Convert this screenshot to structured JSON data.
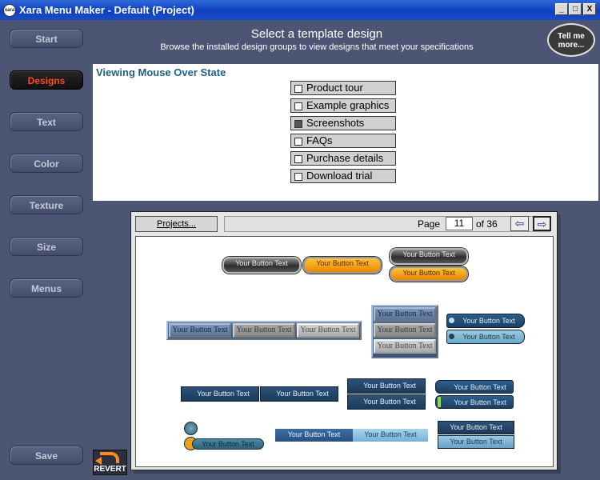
{
  "window": {
    "title": "Xara Menu Maker - Default (Project)",
    "minimize_glyph": "_",
    "maximize_glyph": "□",
    "close_glyph": "X"
  },
  "sidebar": {
    "items": [
      {
        "label": "Start",
        "active": false
      },
      {
        "label": "Designs",
        "active": true
      },
      {
        "label": "Text",
        "active": false
      },
      {
        "label": "Color",
        "active": false
      },
      {
        "label": "Texture",
        "active": false
      },
      {
        "label": "Size",
        "active": false
      },
      {
        "label": "Menus",
        "active": false
      }
    ],
    "save_label": "Save"
  },
  "header": {
    "title": "Select a template design",
    "subtitle": "Browse the installed design groups to view designs that meet your specifications",
    "tell_me_line1": "Tell me",
    "tell_me_line2": "more..."
  },
  "preview": {
    "label": "Viewing Mouse Over State",
    "items": [
      {
        "label": "Product tour",
        "hover": false
      },
      {
        "label": "Example graphics",
        "hover": false
      },
      {
        "label": "Screenshots",
        "hover": true
      },
      {
        "label": "FAQs",
        "hover": false
      },
      {
        "label": "Purchase details",
        "hover": false
      },
      {
        "label": "Download trial",
        "hover": false
      }
    ]
  },
  "browser": {
    "projects_label": "Projects...",
    "page_label": "Page",
    "page_value": "11",
    "of_label": "of",
    "total_pages": "36",
    "prev_icon": "arrow-left-icon",
    "next_icon": "arrow-right-icon",
    "button_text": "Your Button Text"
  },
  "revert": {
    "label": "REVERT"
  },
  "colors": {
    "accent_active": "#ff4a1a",
    "background": "#4c5674",
    "label_teal": "#1d5f86",
    "title_bar": "#0f3fbf"
  }
}
